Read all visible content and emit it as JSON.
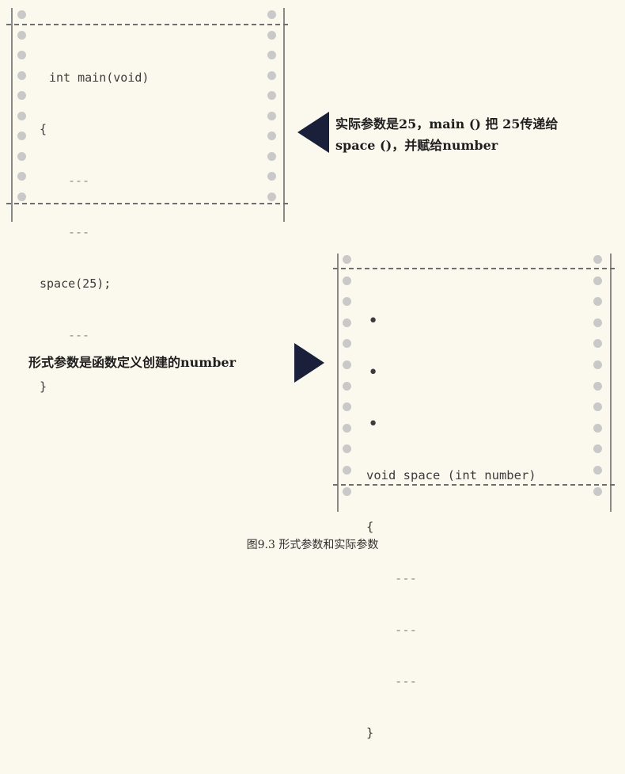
{
  "figure": {
    "caption": "图9.3 形式参数和实际参数",
    "top_listing": {
      "lines": [
        "int main(void)",
        "{",
        "---",
        "---",
        "space(25);",
        "---",
        "}"
      ]
    },
    "top_note": {
      "line1": "实际参数是25，main () 把 25传递给",
      "line2": "space ()，并赋给number"
    },
    "bottom_listing": {
      "lines": [
        "•",
        "•",
        "•",
        "void space (int number)",
        "{",
        "---",
        "---",
        "---",
        "}"
      ]
    },
    "bottom_note": {
      "text": "形式参数是函数定义创建的number"
    },
    "colors": {
      "arrow": "#1a1f3a",
      "background": "#fbf8ed",
      "sprocket_hole": "#c9c9c9"
    },
    "icons": [
      "left-pointing-triangle-icon",
      "right-pointing-triangle-icon"
    ]
  }
}
